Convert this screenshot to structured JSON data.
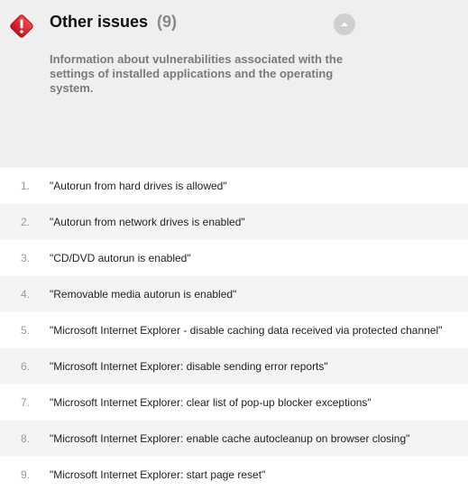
{
  "section": {
    "icon": "alert-icon",
    "accent_color": "#e0202a",
    "title": "Other issues",
    "count": "(9)",
    "description": "Information about vulnerabilities associated with the settings of installed applications and the operating system.",
    "collapse_icon": "chevron-up-icon"
  },
  "issues": [
    {
      "num": "1.",
      "text": "\"Autorun from hard drives is allowed\""
    },
    {
      "num": "2.",
      "text": "\"Autorun from network drives is enabled\""
    },
    {
      "num": "3.",
      "text": "\"CD/DVD autorun is enabled\""
    },
    {
      "num": "4.",
      "text": "\"Removable media autorun is enabled\""
    },
    {
      "num": "5.",
      "text": "\"Microsoft Internet Explorer - disable caching data received via protected channel\""
    },
    {
      "num": "6.",
      "text": "\"Microsoft Internet Explorer: disable sending error reports\""
    },
    {
      "num": "7.",
      "text": "\"Microsoft Internet Explorer: clear list of pop-up blocker exceptions\""
    },
    {
      "num": "8.",
      "text": "\"Microsoft Internet Explorer: enable cache autocleanup on browser closing\""
    },
    {
      "num": "9.",
      "text": "\"Microsoft Internet Explorer: start page reset\""
    }
  ]
}
